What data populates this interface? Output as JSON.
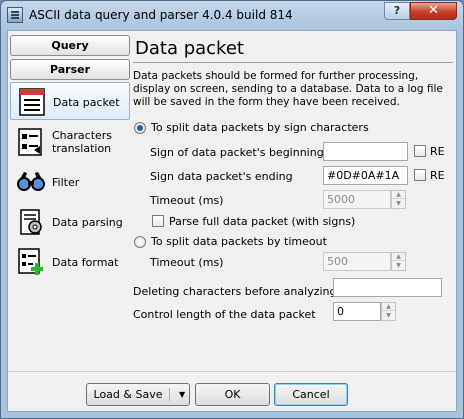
{
  "window": {
    "title": "ASCII data query and parser 4.0.4 build 814",
    "help_label": "?",
    "close_label": "✕"
  },
  "sidebar": {
    "query_label": "Query",
    "parser_label": "Parser",
    "items": [
      {
        "label": "Data packet",
        "icon": "data-packet-icon",
        "selected": true
      },
      {
        "label": "Characters translation",
        "icon": "characters-translation-icon",
        "selected": false
      },
      {
        "label": "Filter",
        "icon": "filter-icon",
        "selected": false
      },
      {
        "label": "Data parsing",
        "icon": "data-parsing-icon",
        "selected": false
      },
      {
        "label": "Data format",
        "icon": "data-format-icon",
        "selected": false
      }
    ]
  },
  "main": {
    "heading": "Data packet",
    "description": "Data packets should be formed for further processing, display on screen, sending to a database. Data to a log file will be saved in the form they have been received.",
    "split_by_sign": {
      "label": "To split data packets by sign characters",
      "selected": true,
      "beginning_label": "Sign of data packet's beginning",
      "beginning_value": "",
      "beginning_re_label": "RE",
      "ending_label": "Sign data packet's ending",
      "ending_value": "#0D#0A#1A",
      "ending_re_label": "RE",
      "timeout_label": "Timeout (ms)",
      "timeout_value": "5000",
      "parse_full_label": "Parse full data packet (with signs)"
    },
    "split_by_timeout": {
      "label": "To split data packets by timeout",
      "selected": false,
      "timeout_label": "Timeout (ms)",
      "timeout_value": "500"
    },
    "deleting_label": "Deleting characters before analyzing",
    "deleting_value": "",
    "control_length_label": "Control length of the data packet",
    "control_length_value": "0"
  },
  "footer": {
    "load_save_label": "Load & Save",
    "ok_label": "OK",
    "cancel_label": "Cancel"
  },
  "colors": {
    "selection": "#dcebfb",
    "titlebar": "#a9c3de",
    "close": "#c7402a"
  }
}
